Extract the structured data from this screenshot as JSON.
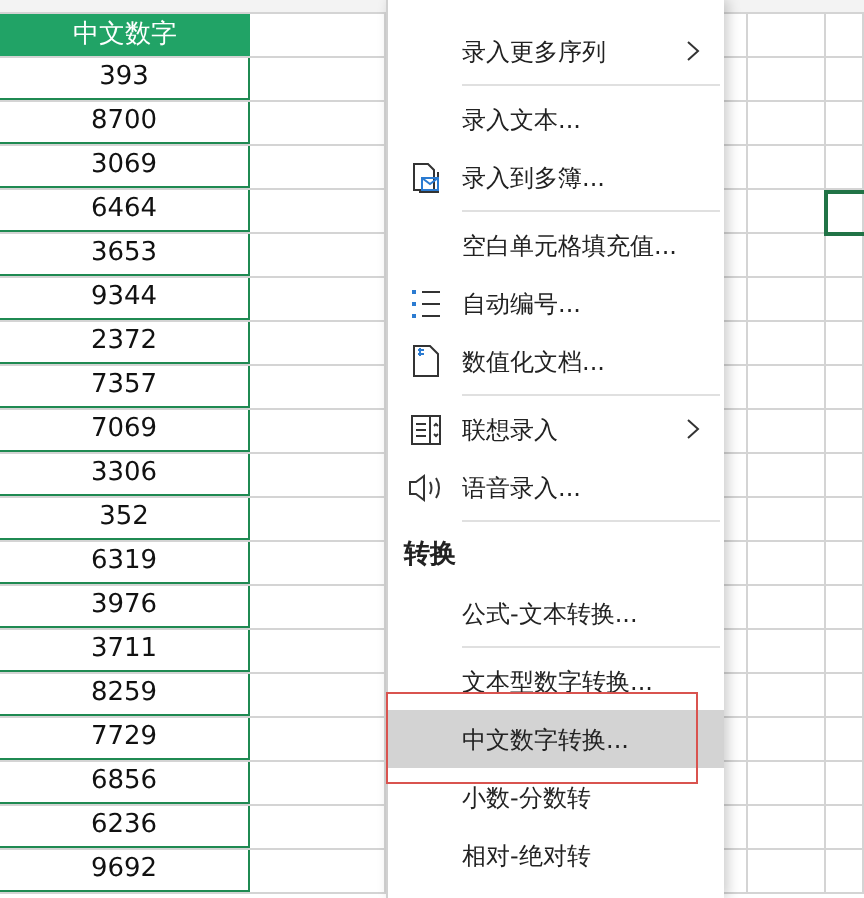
{
  "sheet": {
    "header": "中文数字",
    "values": [
      "393",
      "8700",
      "3069",
      "6464",
      "3653",
      "9344",
      "2372",
      "7357",
      "7069",
      "3306",
      "352",
      "6319",
      "3976",
      "3711",
      "8259",
      "7729",
      "6856",
      "6236",
      "9692"
    ]
  },
  "menu": {
    "items": [
      {
        "kind": "item",
        "label": "录入更多序列",
        "submenu": true,
        "selected": false
      },
      {
        "kind": "divider"
      },
      {
        "kind": "item",
        "label": "录入文本...",
        "submenu": false,
        "selected": false
      },
      {
        "kind": "item",
        "label": "录入到多簿...",
        "submenu": false,
        "selected": false
      },
      {
        "kind": "divider"
      },
      {
        "kind": "item",
        "label": "空白单元格填充值...",
        "submenu": false,
        "selected": false
      },
      {
        "kind": "item",
        "label": "自动编号...",
        "submenu": false,
        "selected": false
      },
      {
        "kind": "item",
        "label": "数值化文档...",
        "submenu": false,
        "selected": false
      },
      {
        "kind": "divider"
      },
      {
        "kind": "item",
        "label": "联想录入",
        "submenu": true,
        "selected": false
      },
      {
        "kind": "item",
        "label": "语音录入...",
        "submenu": false,
        "selected": false
      },
      {
        "kind": "divider"
      },
      {
        "kind": "header",
        "label": "转换"
      },
      {
        "kind": "item",
        "label": "公式-文本转换...",
        "submenu": false,
        "selected": false
      },
      {
        "kind": "divider"
      },
      {
        "kind": "item",
        "label": "文本型数字转换...",
        "submenu": false,
        "selected": false
      },
      {
        "kind": "item",
        "label": "中文数字转换...",
        "submenu": false,
        "selected": true
      },
      {
        "kind": "item",
        "label": "小数-分数转",
        "submenu": false,
        "selected": false
      },
      {
        "kind": "item",
        "label": "相对-绝对转",
        "submenu": false,
        "selected": false
      }
    ]
  }
}
